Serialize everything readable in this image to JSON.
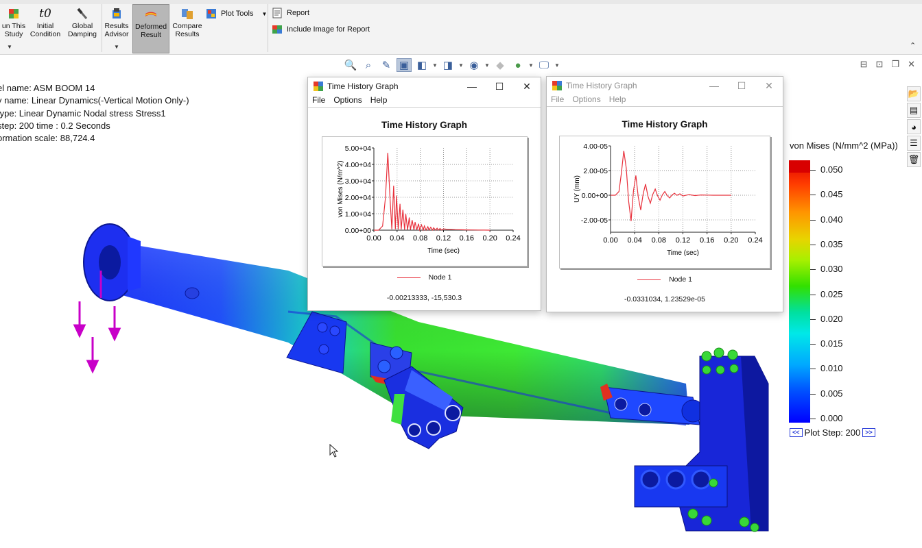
{
  "ribbon": {
    "buttons": [
      {
        "label": "un This\nStudy",
        "icon": "run-study-icon"
      },
      {
        "label": "Initial\nCondition",
        "icon": "initial-condition-icon",
        "glyph": "t0"
      },
      {
        "label": "Global\nDamping",
        "icon": "damping-icon"
      },
      {
        "label": "Results\nAdvisor",
        "icon": "results-advisor-icon"
      },
      {
        "label": "Deformed\nResult",
        "icon": "deformed-result-icon",
        "active": true
      },
      {
        "label": "Compare\nResults",
        "icon": "compare-results-icon"
      }
    ],
    "plot_tools": "Plot Tools",
    "report": "Report",
    "include_image": "Include Image for Report"
  },
  "info": {
    "model_name": "el name: ASM BOOM 14",
    "study_name": "y name: Linear Dynamics(-Vertical Motion Only-)",
    "plot_type": "type: Linear Dynamic Nodal stress Stress1",
    "plot_step": "step: 200   time : 0.2 Seconds",
    "deformation_scale": "ormation scale: 88,724.4"
  },
  "graph1": {
    "window_title": "Time History Graph",
    "menu": [
      "File",
      "Options",
      "Help"
    ],
    "heading": "Time History Graph",
    "legend": "Node 1",
    "coords": "-0.00213333, -15,530.3",
    "chart_data": {
      "type": "line",
      "xlabel": "Time (sec)",
      "ylabel": "von Mises (N/m^2)",
      "xlim": [
        0,
        0.24
      ],
      "ylim": [
        0,
        50000
      ],
      "xticks": [
        "0.00",
        "0.04",
        "0.08",
        "0.12",
        "0.16",
        "0.20",
        "0.24"
      ],
      "yticks": [
        "0.00+00",
        "1.00+04",
        "2.00+04",
        "3.00+04",
        "4.00+04",
        "5.00+04"
      ],
      "grid": true,
      "series": [
        {
          "name": "Node 1",
          "color": "#e8303b",
          "x": [
            0.0,
            0.008,
            0.015,
            0.02,
            0.024,
            0.028,
            0.031,
            0.034,
            0.037,
            0.039,
            0.042,
            0.045,
            0.047,
            0.05,
            0.053,
            0.055,
            0.058,
            0.061,
            0.063,
            0.066,
            0.069,
            0.071,
            0.074,
            0.077,
            0.079,
            0.082,
            0.085,
            0.087,
            0.09,
            0.093,
            0.095,
            0.098,
            0.101,
            0.103,
            0.106,
            0.109,
            0.111,
            0.114,
            0.117,
            0.12,
            0.125,
            0.13,
            0.14,
            0.15,
            0.16,
            0.17,
            0.18,
            0.19,
            0.2
          ],
          "y": [
            0,
            0,
            2500,
            20000,
            47000,
            18000,
            500,
            27000,
            600,
            21000,
            500,
            16000,
            400,
            12500,
            300,
            9800,
            250,
            7700,
            200,
            6100,
            180,
            4900,
            150,
            3900,
            120,
            3200,
            100,
            2600,
            90,
            2100,
            80,
            1750,
            70,
            1450,
            60,
            1200,
            50,
            1000,
            40,
            800,
            600,
            500,
            350,
            250,
            180,
            120,
            80,
            40,
            0
          ]
        }
      ]
    }
  },
  "graph2": {
    "window_title": "Time History Graph",
    "menu": [
      "File",
      "Options",
      "Help"
    ],
    "heading": "Time History Graph",
    "legend": "Node 1",
    "coords": "-0.0331034, 1.23529e-05",
    "chart_data": {
      "type": "line",
      "xlabel": "Time (sec)",
      "ylabel": "UY (mm)",
      "xlim": [
        0,
        0.24
      ],
      "ylim": [
        -3e-05,
        4e-05
      ],
      "xticks": [
        "0.00",
        "0.04",
        "0.08",
        "0.12",
        "0.16",
        "0.20",
        "0.24"
      ],
      "yticks": [
        "4.00-05",
        "2.00-05",
        "0.00+00",
        "-2.00-05"
      ],
      "grid": true,
      "series": [
        {
          "name": "Node 1",
          "color": "#e8303b",
          "x": [
            0.0,
            0.008,
            0.014,
            0.018,
            0.022,
            0.026,
            0.03,
            0.034,
            0.038,
            0.042,
            0.046,
            0.05,
            0.054,
            0.058,
            0.062,
            0.066,
            0.07,
            0.074,
            0.078,
            0.082,
            0.086,
            0.09,
            0.094,
            0.098,
            0.102,
            0.106,
            0.11,
            0.115,
            0.12,
            0.13,
            0.14,
            0.15,
            0.16,
            0.17,
            0.18,
            0.2
          ],
          "y": [
            0,
            0,
            3e-06,
            1.8e-05,
            3.6e-05,
            2.2e-05,
            -5e-06,
            -2.1e-05,
            3.5e-06,
            1.6e-05,
            -1.5e-06,
            -1.2e-05,
            1e-06,
            9e-06,
            -8e-07,
            -6.5e-06,
            6e-07,
            5e-06,
            -5e-07,
            -4e-06,
            4e-07,
            3e-06,
            -3e-07,
            -2.2e-06,
            2e-07,
            1.6e-06,
            -1e-07,
            1.1e-06,
            -6e-07,
            5e-07,
            -3e-07,
            2e-07,
            1e-07,
            0.0,
            0.0,
            0.0
          ]
        }
      ]
    }
  },
  "color_legend": {
    "title": "von Mises (N/mm^2 (MPa))",
    "values": [
      "0.050",
      "0.045",
      "0.040",
      "0.035",
      "0.030",
      "0.025",
      "0.020",
      "0.015",
      "0.010",
      "0.005",
      "0.000"
    ],
    "plot_step_label": "Plot Step: 200",
    "prev": "<<",
    "next": ">>"
  }
}
